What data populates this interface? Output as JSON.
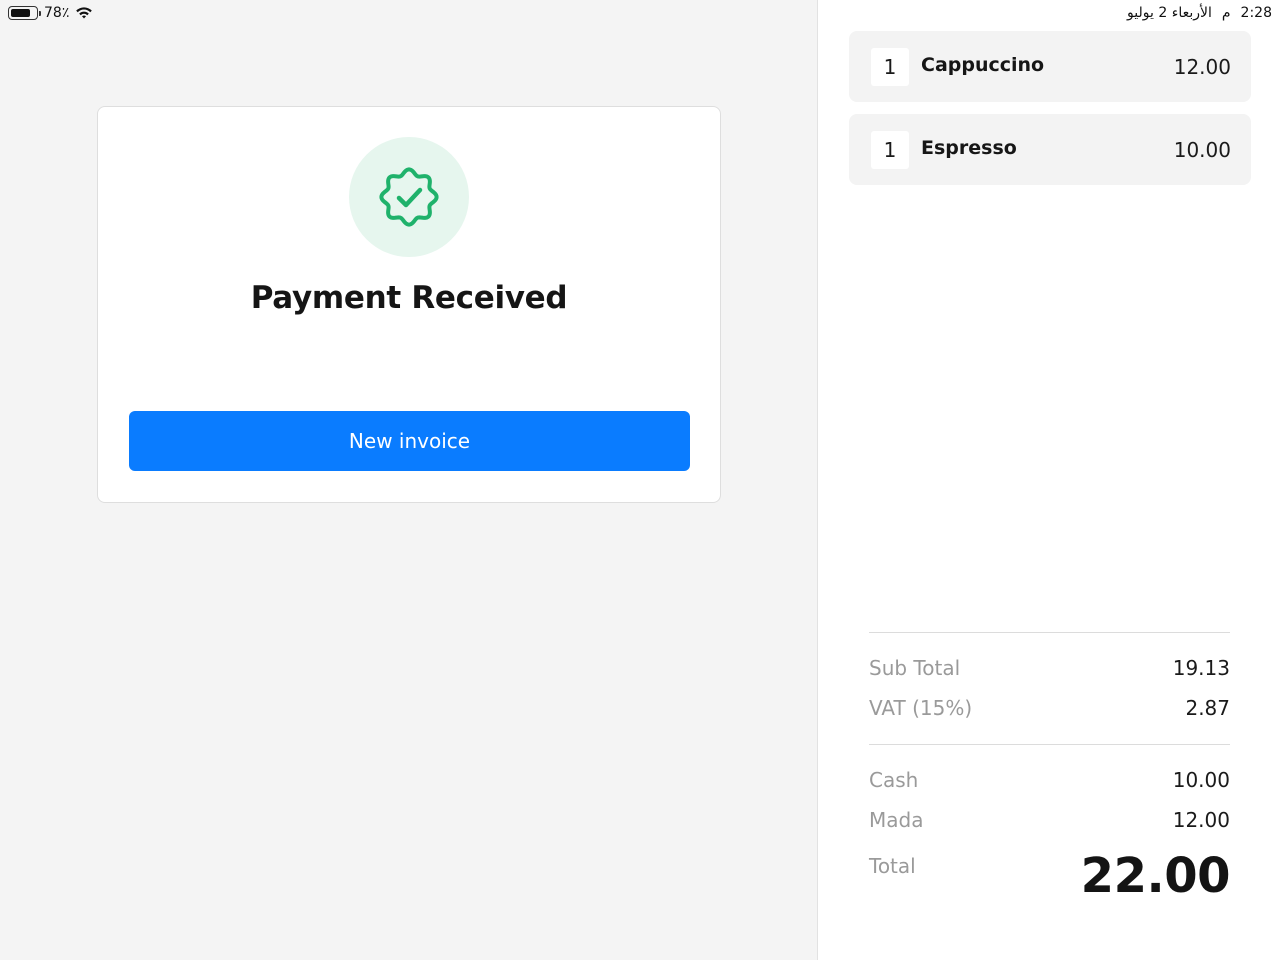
{
  "status_bar": {
    "battery_percent": "78٪",
    "battery_level": 0.78,
    "time": "2:28",
    "ampm": "م",
    "date": "الأربعاء 2 يوليو"
  },
  "payment": {
    "title": "Payment Received",
    "status_icon": "check-badge-icon",
    "button_label": "New invoice"
  },
  "order": {
    "items": [
      {
        "qty": "1",
        "name": "Cappuccino",
        "price": "12.00"
      },
      {
        "qty": "1",
        "name": "Espresso",
        "price": "10.00"
      }
    ],
    "subtotal_label": "Sub Total",
    "subtotal": "19.13",
    "vat_label": "VAT (15%)",
    "vat": "2.87",
    "payments": [
      {
        "label": "Cash",
        "amount": "10.00"
      },
      {
        "label": "Mada",
        "amount": "12.00"
      }
    ],
    "total_label": "Total",
    "total": "22.00"
  },
  "colors": {
    "accent": "#0a7cff",
    "success": "#1fb26b",
    "success_bg": "#e6f6ee"
  }
}
